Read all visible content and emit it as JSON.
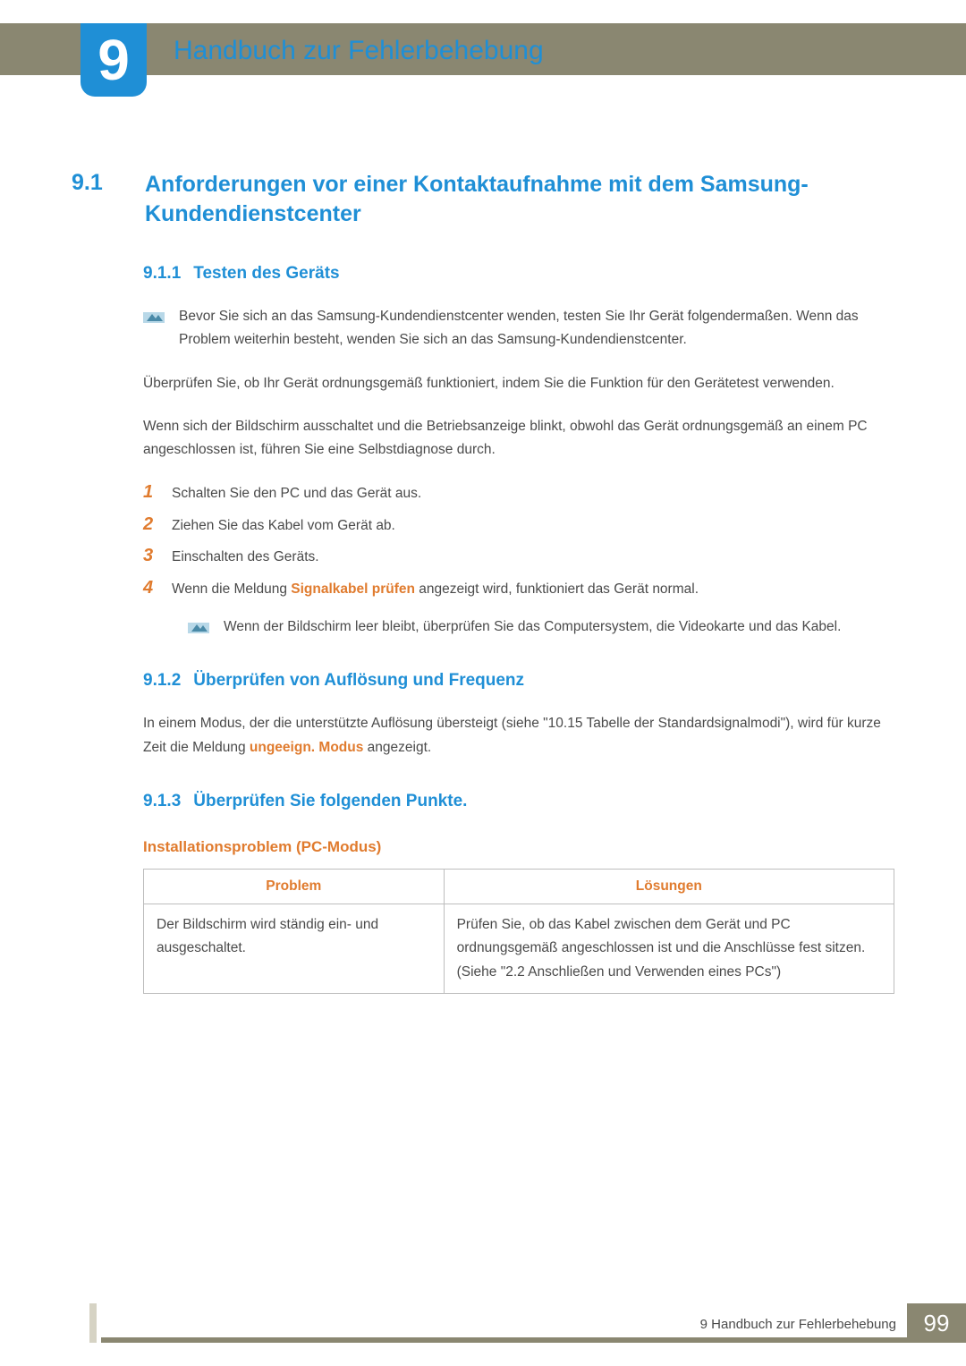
{
  "chapter": {
    "number": "9",
    "title": "Handbuch zur Fehlerbehebung"
  },
  "section": {
    "number": "9.1",
    "title": "Anforderungen vor einer Kontaktaufnahme mit dem Samsung-Kundendienstcenter"
  },
  "sub1": {
    "number": "9.1.1",
    "title": "Testen des Geräts",
    "note": "Bevor Sie sich an das Samsung-Kundendienstcenter wenden, testen Sie Ihr Gerät folgendermaßen. Wenn das Problem weiterhin besteht, wenden Sie sich an das Samsung-Kundendienstcenter.",
    "p1": "Überprüfen Sie, ob Ihr Gerät ordnungsgemäß funktioniert, indem Sie die Funktion für den Gerätetest verwenden.",
    "p2": "Wenn sich der Bildschirm ausschaltet und die Betriebsanzeige blinkt, obwohl das Gerät ordnungsgemäß an einem PC angeschlossen ist, führen Sie eine Selbstdiagnose durch.",
    "steps": [
      "Schalten Sie den PC und das Gerät aus.",
      "Ziehen Sie das Kabel vom Gerät ab.",
      "Einschalten des Geräts."
    ],
    "step4_a": "Wenn die Meldung ",
    "step4_b": "Signalkabel prüfen",
    "step4_c": " angezeigt wird, funktioniert das Gerät normal.",
    "nested_note": "Wenn der Bildschirm leer bleibt, überprüfen Sie das Computersystem, die Videokarte und das Kabel."
  },
  "sub2": {
    "number": "9.1.2",
    "title": "Überprüfen von Auflösung und Frequenz",
    "p_a": "In einem Modus, der die unterstützte Auflösung übersteigt (siehe \"10.15 Tabelle der Standardsignalmodi\"), wird für kurze Zeit die Meldung ",
    "p_b": "ungeeign. Modus",
    "p_c": " angezeigt."
  },
  "sub3": {
    "number": "9.1.3",
    "title": "Überprüfen Sie folgenden Punkte.",
    "topic": "Installationsproblem (PC-Modus)",
    "th_problem": "Problem",
    "th_solution": "Lösungen",
    "row1_problem": "Der Bildschirm wird ständig ein- und ausgeschaltet.",
    "row1_solution": "Prüfen Sie, ob das Kabel zwischen dem Gerät und PC ordnungsgemäß angeschlossen ist und die Anschlüsse fest sitzen. (Siehe \"2.2 Anschließen und Verwenden eines PCs\")"
  },
  "footer": {
    "text": "9 Handbuch zur Fehlerbehebung",
    "page": "99"
  }
}
